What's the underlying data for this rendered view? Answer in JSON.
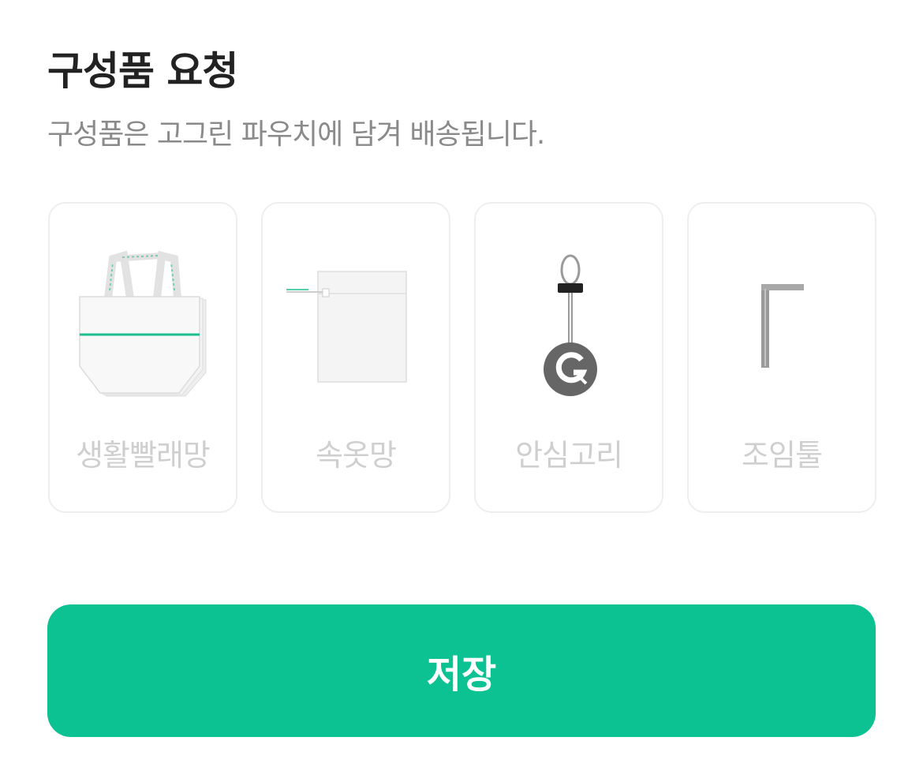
{
  "page": {
    "title": "구성품 요청",
    "subtitle": "구성품은 고그린 파우치에 담겨 배송됩니다."
  },
  "items": [
    {
      "label": "생활빨래망",
      "icon": "tote-bag-icon"
    },
    {
      "label": "속옷망",
      "icon": "laundry-pouch-icon"
    },
    {
      "label": "안심고리",
      "icon": "safety-hook-icon"
    },
    {
      "label": "조임툴",
      "icon": "hex-key-icon"
    }
  ],
  "save_button": {
    "label": "저장"
  },
  "colors": {
    "accent": "#0cc292",
    "title": "#222222",
    "subtitle": "#8a8a8a",
    "card_label": "#cfcfcf",
    "card_border": "#eeeeee"
  }
}
